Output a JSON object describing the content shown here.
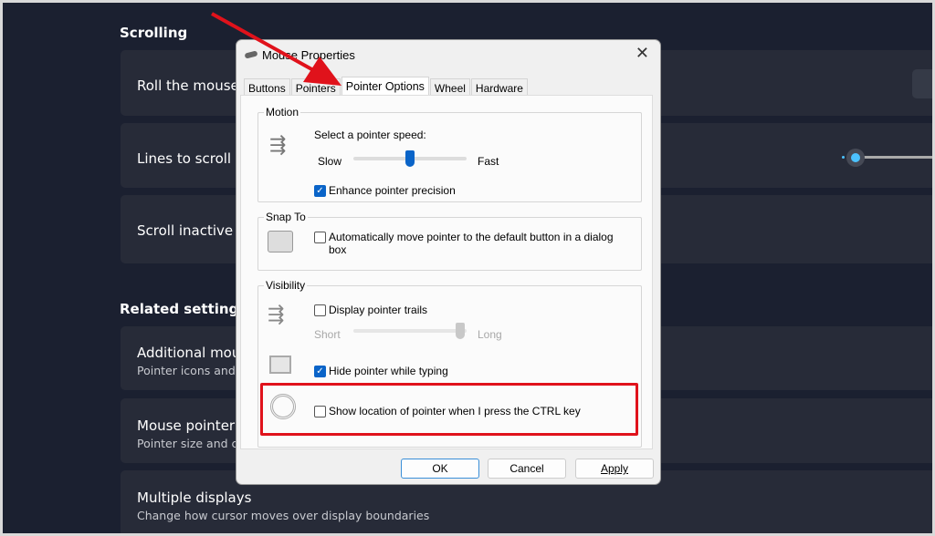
{
  "settings": {
    "scrolling_heading": "Scrolling",
    "scroll_cards": [
      "Roll the mouse wheel to scroll",
      "Lines to scroll at a time",
      "Scroll inactive windows when hovering over them"
    ],
    "related_heading": "Related settings",
    "related_cards": [
      {
        "title": "Additional mouse settings",
        "subtitle": "Pointer icons and visibility"
      },
      {
        "title": "Mouse pointer",
        "subtitle": "Pointer size and color"
      },
      {
        "title": "Multiple displays",
        "subtitle": "Change how cursor moves over display boundaries"
      }
    ],
    "lines_slider_color": "#4cc2ff"
  },
  "dialog": {
    "title": "Mouse Properties",
    "tabs": [
      "Buttons",
      "Pointers",
      "Pointer Options",
      "Wheel",
      "Hardware"
    ],
    "active_tab": "Pointer Options",
    "motion": {
      "label": "Motion",
      "speed_label": "Select a pointer speed:",
      "slow": "Slow",
      "fast": "Fast",
      "speed_value_percent": 55,
      "enhance": "Enhance pointer precision",
      "enhance_checked": true
    },
    "snap": {
      "label": "Snap To",
      "text": "Automatically move pointer to the default button in a dialog box",
      "checked": false
    },
    "visibility": {
      "label": "Visibility",
      "trails": "Display pointer trails",
      "trails_checked": false,
      "short": "Short",
      "long": "Long",
      "trails_value_percent": 100,
      "hide": "Hide pointer while typing",
      "hide_checked": true,
      "ctrl": "Show location of pointer when I press the CTRL key",
      "ctrl_checked": false
    },
    "buttons": {
      "ok": "OK",
      "cancel": "Cancel",
      "apply": "Apply"
    }
  },
  "annotation_color": "#e0121b"
}
